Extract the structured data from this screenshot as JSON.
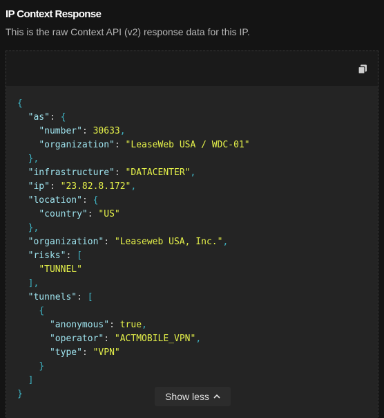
{
  "header": {
    "title": "IP Context Response",
    "subtitle": "This is the raw Context API (v2) response data for this IP."
  },
  "toolbar": {
    "copy_icon": "copy-icon"
  },
  "json_response": {
    "as_key": "\"as\"",
    "number_key": "\"number\"",
    "number_value": "30633",
    "organization_key": "\"organization\"",
    "as_organization_value": "\"LeaseWeb USA / WDC-01\"",
    "infrastructure_key": "\"infrastructure\"",
    "infrastructure_value": "\"DATACENTER\"",
    "ip_key": "\"ip\"",
    "ip_value": "\"23.82.8.172\"",
    "location_key": "\"location\"",
    "country_key": "\"country\"",
    "country_value": "\"US\"",
    "org_key": "\"organization\"",
    "org_value": "\"Leaseweb USA, Inc.\"",
    "risks_key": "\"risks\"",
    "risk_0": "\"TUNNEL\"",
    "tunnels_key": "\"tunnels\"",
    "anonymous_key": "\"anonymous\"",
    "anonymous_value": "true",
    "operator_key": "\"operator\"",
    "operator_value": "\"ACTMOBILE_VPN\"",
    "type_key": "\"type\"",
    "type_value": "\"VPN\""
  },
  "footer": {
    "show_less_label": "Show less",
    "chevron_icon": "chevron-up-icon"
  }
}
